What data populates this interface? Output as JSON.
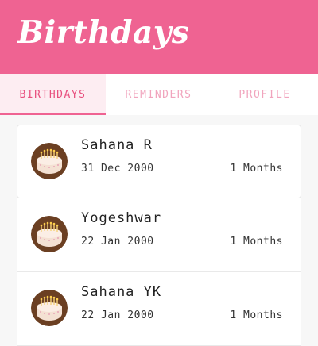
{
  "app_bar": {
    "title": "Birthdays",
    "color": "#ef6392"
  },
  "tabs": [
    {
      "label": "BIRTHDAYS",
      "active": true
    },
    {
      "label": "REMINDERS",
      "active": false
    },
    {
      "label": "PROFILE",
      "active": false
    }
  ],
  "birthdays": [
    {
      "name": "Sahana R",
      "date": "31 Dec 2000",
      "months": "1 Months",
      "avatar": "cake-icon"
    },
    {
      "name": "Yogeshwar",
      "date": "22 Jan 2000",
      "months": "1 Months",
      "avatar": "cake-icon"
    },
    {
      "name": "Sahana YK",
      "date": "22 Jan 2000",
      "months": "1 Months",
      "avatar": "cake-icon"
    }
  ]
}
